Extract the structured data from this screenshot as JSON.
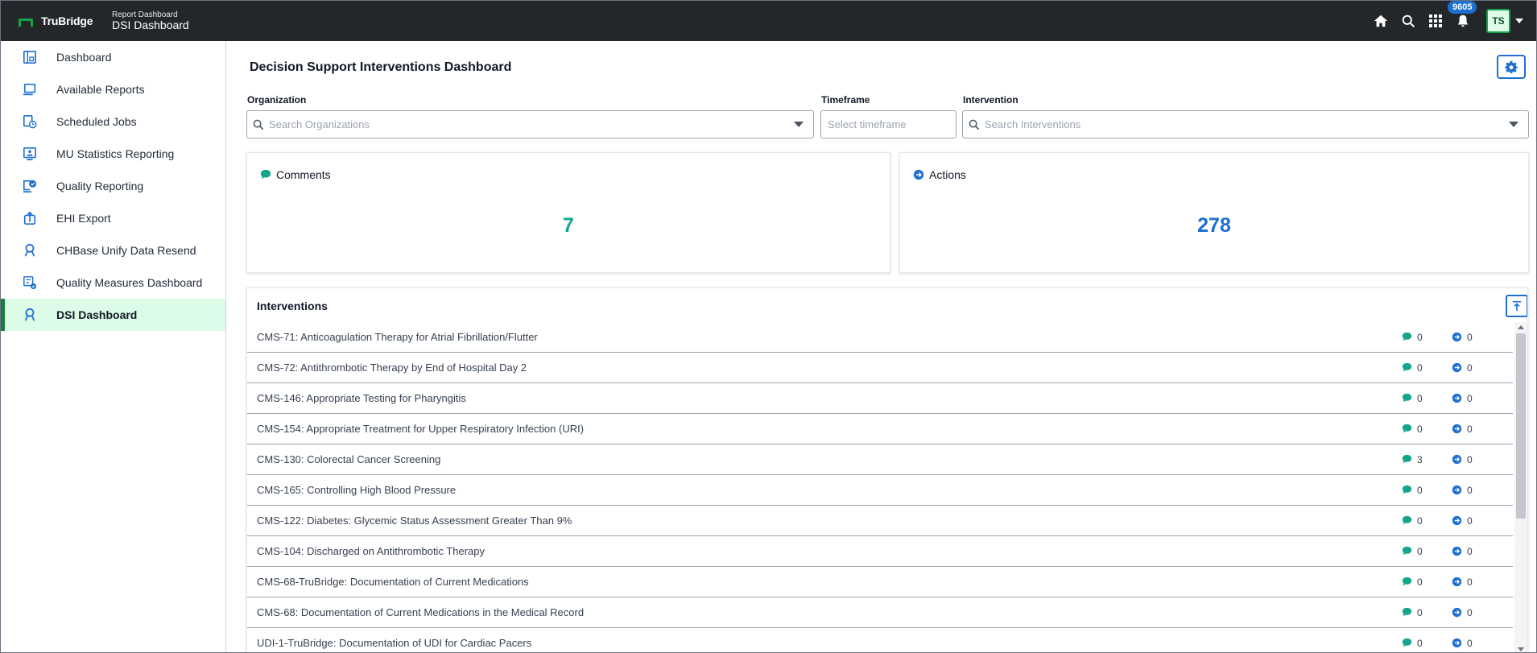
{
  "brand": {
    "name": "TruBridge"
  },
  "header": {
    "crumb_small": "Report Dashboard",
    "crumb_big": "DSI Dashboard",
    "notification_count": "9605",
    "user_initials": "TS"
  },
  "sidebar": {
    "items": [
      {
        "label": "Dashboard",
        "icon": "dashboard-icon"
      },
      {
        "label": "Available Reports",
        "icon": "laptop-icon"
      },
      {
        "label": "Scheduled Jobs",
        "icon": "clock-report-icon"
      },
      {
        "label": "MU Statistics Reporting",
        "icon": "person-monitor-icon"
      },
      {
        "label": "Quality Reporting",
        "icon": "check-report-icon"
      },
      {
        "label": "EHI Export",
        "icon": "export-box-icon"
      },
      {
        "label": "CHBase Unify Data Resend",
        "icon": "ribbon-icon"
      },
      {
        "label": "Quality Measures Dashboard",
        "icon": "measures-icon"
      },
      {
        "label": "DSI Dashboard",
        "icon": "ribbon-icon",
        "active": true
      }
    ]
  },
  "main": {
    "title": "Decision Support Interventions Dashboard",
    "filters": {
      "organization": {
        "label": "Organization",
        "placeholder": "Search Organizations"
      },
      "timeframe": {
        "label": "Timeframe",
        "placeholder": "Select timeframe"
      },
      "intervention": {
        "label": "Intervention",
        "placeholder": "Search Interventions"
      }
    },
    "cards": {
      "comments": {
        "label": "Comments",
        "value": "7"
      },
      "actions": {
        "label": "Actions",
        "value": "278"
      }
    },
    "interventions": {
      "title": "Interventions",
      "rows": [
        {
          "name": "CMS-71: Anticoagulation Therapy for Atrial Fibrillation/Flutter",
          "comments": "0",
          "actions": "0"
        },
        {
          "name": "CMS-72: Antithrombotic Therapy by End of Hospital Day 2",
          "comments": "0",
          "actions": "0"
        },
        {
          "name": "CMS-146: Appropriate Testing for Pharyngitis",
          "comments": "0",
          "actions": "0"
        },
        {
          "name": "CMS-154: Appropriate Treatment for Upper Respiratory Infection (URI)",
          "comments": "0",
          "actions": "0"
        },
        {
          "name": "CMS-130: Colorectal Cancer Screening",
          "comments": "3",
          "actions": "0"
        },
        {
          "name": "CMS-165: Controlling High Blood Pressure",
          "comments": "0",
          "actions": "0"
        },
        {
          "name": "CMS-122: Diabetes: Glycemic Status Assessment Greater Than 9%",
          "comments": "0",
          "actions": "0"
        },
        {
          "name": "CMS-104: Discharged on Antithrombotic Therapy",
          "comments": "0",
          "actions": "0"
        },
        {
          "name": "CMS-68-TruBridge: Documentation of Current Medications",
          "comments": "0",
          "actions": "0"
        },
        {
          "name": "CMS-68: Documentation of Current Medications in the Medical Record",
          "comments": "0",
          "actions": "0"
        },
        {
          "name": "UDI-1-TruBridge: Documentation of UDI for Cardiac Pacers",
          "comments": "0",
          "actions": "0"
        }
      ]
    }
  },
  "colors": {
    "topbar": "#24272a",
    "brand_green": "#16a34a",
    "accent_blue": "#1d6fd1",
    "comments_teal": "#14a58c",
    "active_bg": "#dcfce7"
  }
}
